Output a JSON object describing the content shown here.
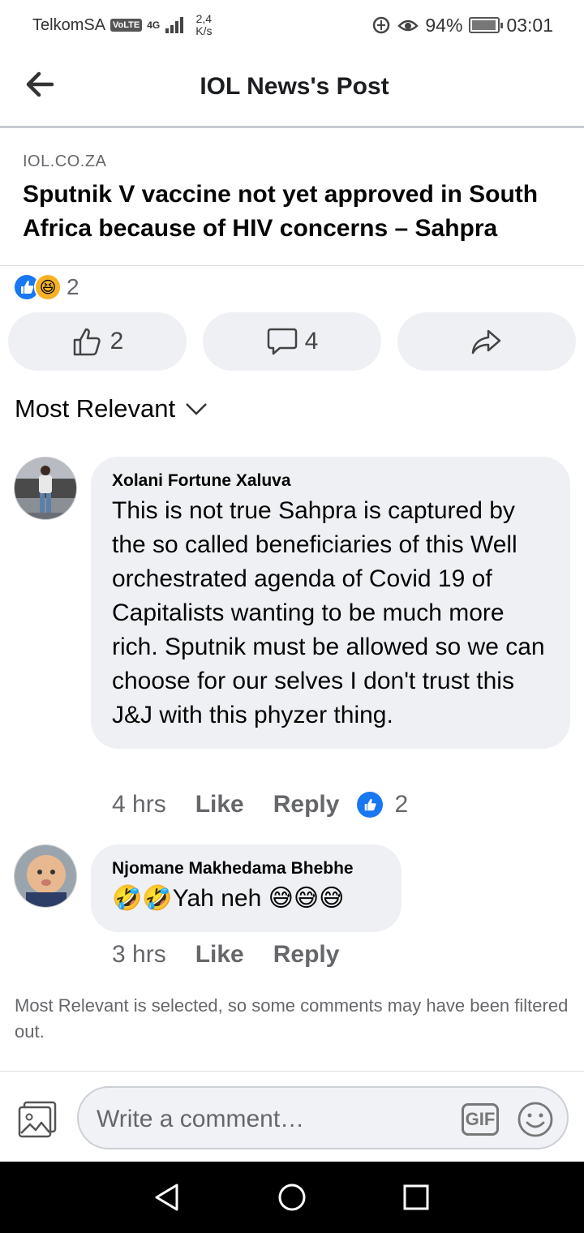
{
  "status_bar": {
    "carrier": "TelkomSA",
    "volte": "VoLTE",
    "network": "4G",
    "speed_value": "2,4",
    "speed_unit": "K/s",
    "battery": "94%",
    "battery_level": 0.94,
    "time": "03:01"
  },
  "header": {
    "title": "IOL News's Post"
  },
  "link_preview": {
    "domain": "IOL.CO.ZA",
    "title": "Sputnik V vaccine not yet approved in South Africa because of HIV concerns – Sahpra"
  },
  "reactions": {
    "count": "2",
    "icons": [
      "like-icon",
      "haha-icon"
    ]
  },
  "actions": {
    "like_count": "2",
    "comment_count": "4"
  },
  "sort": {
    "label": "Most Relevant"
  },
  "comments": [
    {
      "author": "Xolani Fortune Xaluva",
      "text": "This is not true Sahpra is captured by the so called  beneficiaries of this Well orchestrated agenda of Covid 19 of Capitalists wanting to be much more rich. Sputnik must be allowed so we can choose for our selves I don't trust this J&J with this phyzer thing.",
      "time": "4 hrs",
      "like_label": "Like",
      "reply_label": "Reply",
      "like_count": "2"
    },
    {
      "author": "Njomane Makhedama Bhebhe",
      "text": "🤣🤣Yah neh 😅😅😅",
      "time": "3 hrs",
      "like_label": "Like",
      "reply_label": "Reply"
    }
  ],
  "filtered_notice": "Most Relevant is selected, so some comments may have been filtered out.",
  "composer": {
    "placeholder": "Write a comment…",
    "gif_label": "GIF"
  },
  "colors": {
    "accent": "#1877f2",
    "bubble": "#eef0f3",
    "secondary_text": "#65676b"
  }
}
